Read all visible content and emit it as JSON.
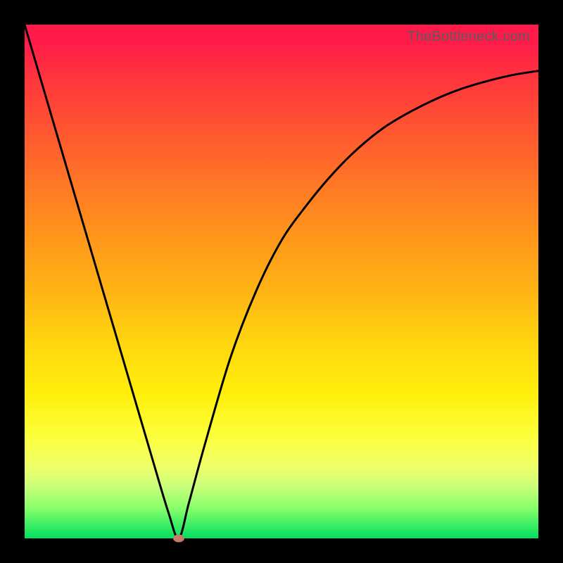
{
  "watermark": "TheBottleneck.com",
  "colors": {
    "curve": "#000000",
    "marker": "#c87a6a"
  },
  "chart_data": {
    "type": "line",
    "title": "",
    "xlabel": "",
    "ylabel": "",
    "xlim": [
      0,
      100
    ],
    "ylim": [
      0,
      100
    ],
    "grid": false,
    "legend": null,
    "series": [
      {
        "name": "bottleneck-curve",
        "x": [
          0,
          5,
          10,
          15,
          20,
          25,
          28,
          30,
          32,
          35,
          40,
          45,
          50,
          55,
          60,
          65,
          70,
          75,
          80,
          85,
          90,
          95,
          100
        ],
        "y": [
          100,
          83,
          66,
          49,
          32,
          15,
          5,
          0,
          7,
          18,
          35,
          48,
          58,
          65,
          71,
          76,
          80,
          83,
          85.5,
          87.5,
          89,
          90.2,
          91
        ]
      }
    ],
    "marker": {
      "x": 30,
      "y": 0
    }
  }
}
